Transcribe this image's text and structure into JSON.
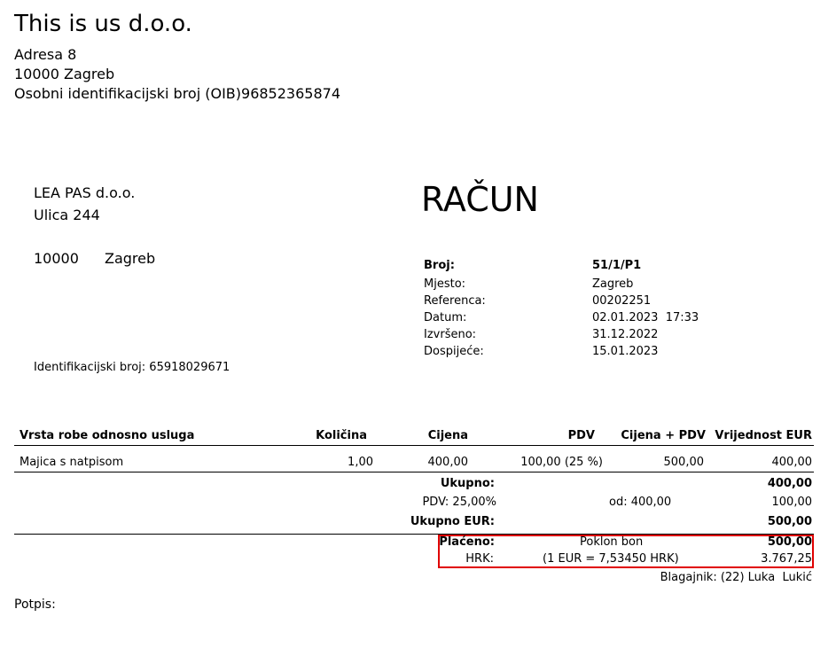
{
  "issuer": {
    "name": "This is us d.o.o.",
    "address": "Adresa 8",
    "city": "10000 Zagreb",
    "oib_line": "Osobni identifikacijski broj (OIB)96852365874"
  },
  "buyer": {
    "name": "LEA PAS d.o.o.",
    "street": "Ulica 244",
    "postal": "10000",
    "city": "Zagreb",
    "id_line": "Identifikacijski broj: 65918029671"
  },
  "invoice": {
    "title": "RAČUN",
    "meta": [
      {
        "label": "Broj:",
        "value": "51/1/P1"
      },
      {
        "label": "Mjesto:",
        "value": "Zagreb"
      },
      {
        "label": "Referenca:",
        "value": "00202251"
      },
      {
        "label": "Datum:",
        "value": "02.01.2023  17:33"
      },
      {
        "label": "Izvršeno:",
        "value": "31.12.2022"
      },
      {
        "label": "Dospijeće:",
        "value": "15.01.2023"
      }
    ]
  },
  "table": {
    "headers": [
      "Vrsta robe odnosno usluga",
      "Količina",
      "Cijena",
      "PDV",
      "Cijena + PDV",
      "Vrijednost EUR"
    ],
    "rows": [
      [
        "Majica s natpisom",
        "1,00",
        "400,00",
        "100,00 (25 %)",
        "500,00",
        "400,00"
      ]
    ]
  },
  "totals": {
    "ukupno_label": "Ukupno:",
    "ukupno_value": "400,00",
    "pdv_label": "PDV: 25,00%",
    "pdv_base": "od: 400,00",
    "pdv_value": "100,00",
    "ukupno_eur_label": "Ukupno EUR:",
    "ukupno_eur_value": "500,00"
  },
  "payment": {
    "placeno_label": "Plaćeno:",
    "method": "Poklon bon",
    "placeno_value": "500,00",
    "hrk_label": "HRK:",
    "rate": "(1 EUR = 7,53450 HRK)",
    "hrk_value": "3.767,25",
    "cashier": "Blagajnik: (22) Luka  Lukić"
  },
  "signature_label": "Potpis:",
  "colors": {
    "highlight_border": "#e00000"
  }
}
